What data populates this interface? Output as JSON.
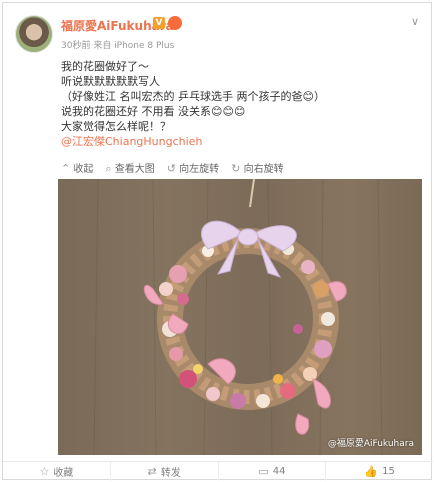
{
  "header": {
    "username": "福原愛AiFukuhara",
    "vip_mark": "V",
    "meta": "30秒前 来自 iPhone 8 Plus",
    "menu_icon": "chevron-down-icon"
  },
  "post": {
    "lines": [
      "我的花圈做好了～",
      "听说默默默默默写人",
      "（好像姓江 名叫宏杰的 乒乓球选手 两个孩子的爸😊）",
      "说我的花圈还好 不用看 没关系😊😊😊",
      "大家觉得怎么样呢！？"
    ],
    "mention": "@江宏傑ChiangHungchieh"
  },
  "image_toolbar": {
    "collapse": "收起",
    "view_large": "查看大图",
    "rotate_left": "向左旋转",
    "rotate_right": "向右旋转"
  },
  "watermark": "@福原愛AiFukuhara",
  "footer": {
    "favorite": "收藏",
    "repost": "转发",
    "comments": "44",
    "likes": "15"
  }
}
